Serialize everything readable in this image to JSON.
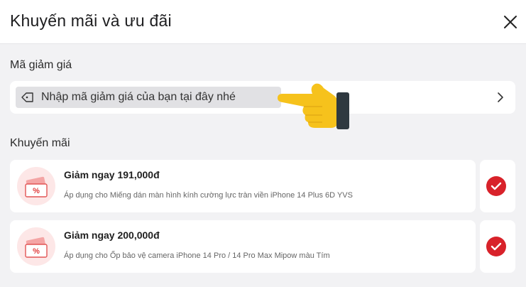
{
  "header": {
    "title": "Khuyến mãi và ưu đãi",
    "close_icon": "close-icon"
  },
  "coupon": {
    "section_label": "Mã giảm giá",
    "placeholder": "Nhập mã giảm giá của bạn tại đây nhé",
    "icon": "tag-icon",
    "chevron_icon": "chevron-right-icon"
  },
  "promotions": {
    "section_label": "Khuyến mãi",
    "items": [
      {
        "title": "Giảm ngay 191,000đ",
        "description": "Áp dụng cho Miếng dán màn hình kính cường lực tràn viền iPhone 14 Plus 6D YVS",
        "selected": true,
        "icon": "discount-ticket-icon"
      },
      {
        "title": "Giảm ngay 200,000đ",
        "description": "Áp dụng cho Ốp bảo vệ camera iPhone 14 Pro / 14 Pro Max Mipow màu Tím",
        "selected": true,
        "icon": "discount-ticket-icon"
      }
    ]
  },
  "colors": {
    "accent_red": "#d8222a",
    "ticket_pink": "#fde7e7",
    "hand_yellow": "#f6c21c",
    "background": "#f2f2f4"
  }
}
